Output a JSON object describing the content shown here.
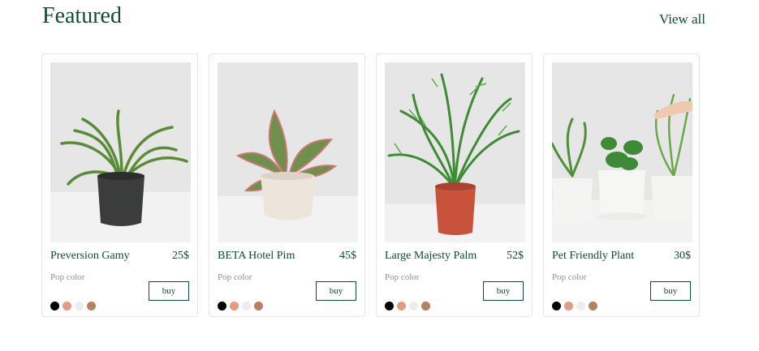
{
  "header": {
    "title": "Featured",
    "view_all": "View all"
  },
  "products": [
    {
      "name": "Preversion Gamy",
      "price": "25$",
      "pop_label": "Pop color",
      "buy_label": "buy",
      "image": "plant-photo-fern-black-pot"
    },
    {
      "name": "BETA Hotel Pim",
      "price": "45$",
      "pop_label": "Pop color",
      "buy_label": "buy",
      "image": "plant-photo-variegated-white-pot"
    },
    {
      "name": "Large Majesty Palm",
      "price": "52$",
      "pop_label": "Pop color",
      "buy_label": "buy",
      "image": "plant-photo-palm-terracotta-pot"
    },
    {
      "name": "Pet Friendly Plant",
      "price": "30$",
      "pop_label": "Pop color",
      "buy_label": "buy",
      "image": "plant-photo-group-white-pots"
    }
  ],
  "swatch_colors": [
    "#000000",
    "#e59a86",
    "#ececec",
    "#b58063"
  ],
  "colors": {
    "accent": "#0f4a3a",
    "muted_text": "#8e8e8e",
    "card_border": "#e4e4e4",
    "photo_bg": "#e4e4e4"
  }
}
